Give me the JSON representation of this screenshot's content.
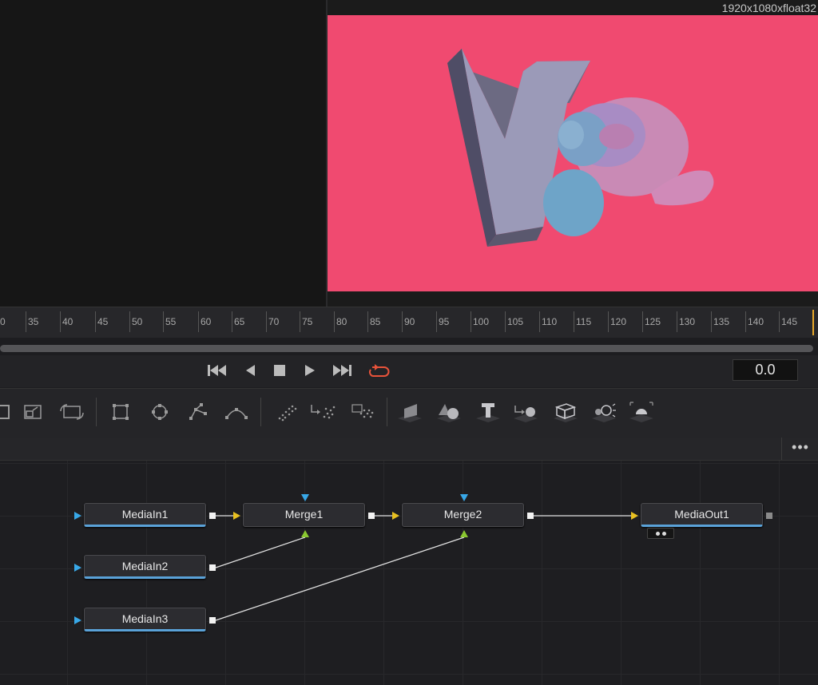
{
  "viewer": {
    "resolution_label": "1920x1080xfloat32",
    "background_color": "#f04a70"
  },
  "timeline": {
    "ticks": [
      "0",
      "35",
      "40",
      "45",
      "50",
      "55",
      "60",
      "65",
      "70",
      "75",
      "80",
      "85",
      "90",
      "95",
      "100",
      "105",
      "110",
      "115",
      "120",
      "125",
      "130",
      "135",
      "140",
      "145"
    ],
    "current_time": "0.0"
  },
  "transport": {
    "buttons": [
      "skip-to-start-icon",
      "step-back-icon",
      "stop-icon",
      "play-icon",
      "skip-to-end-icon",
      "loop-icon"
    ],
    "loop_color": "#e8533a"
  },
  "toolbar": {
    "tools": [
      "transform-icon",
      "resize-icon",
      "crop-icon",
      "rectangle-mask-icon",
      "ellipse-mask-icon",
      "polygon-mask-icon",
      "bspline-mask-icon",
      "particle-emitter-icon",
      "particle-render-icon",
      "particle-pmerge-icon",
      "image-plane-3d-icon",
      "shape-3d-icon",
      "text-3d-icon",
      "merge-3d-icon",
      "camera-3d-icon",
      "spotlight-3d-icon",
      "renderer-3d-icon"
    ]
  },
  "nodebar": {
    "more_label": "•••"
  },
  "nodes": {
    "mediain1": "MediaIn1",
    "mediain2": "MediaIn2",
    "mediain3": "MediaIn3",
    "merge1": "Merge1",
    "merge2": "Merge2",
    "mediaout1": "MediaOut1"
  },
  "colors": {
    "foreground_input": "#e8c020",
    "background_input": "#38a8e8",
    "effect_input": "#8ac830",
    "media_accent": "#5aa2d8"
  }
}
